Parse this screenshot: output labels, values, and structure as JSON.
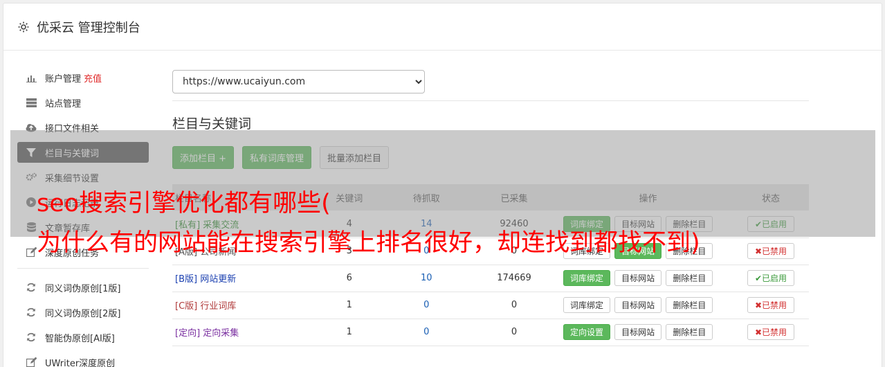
{
  "header": {
    "title": "优采云 管理控制台",
    "icon": "gear-icon"
  },
  "sidebar": {
    "items": [
      {
        "label": "账户管理",
        "badge": "充值",
        "icon": "bar-chart-icon"
      },
      {
        "label": "站点管理",
        "icon": "server-icon"
      },
      {
        "label": "接口文件相关",
        "icon": "cloud-upload-icon"
      },
      {
        "label": "栏目与关键词",
        "icon": "filter-icon"
      },
      {
        "label": "采集细节设置",
        "icon": "gears-icon"
      },
      {
        "label": "运行日志记录",
        "icon": "play-circle-icon"
      },
      {
        "label": "文章暂存库",
        "icon": "database-icon"
      },
      {
        "label": "深度原创任务",
        "icon": "edit-icon"
      }
    ],
    "tools": [
      {
        "label": "同义词伪原创[1版]",
        "icon": "refresh-icon"
      },
      {
        "label": "同义词伪原创[2版]",
        "icon": "refresh-icon"
      },
      {
        "label": "智能伪原创[AI版]",
        "icon": "refresh-icon"
      },
      {
        "label": "UWriter深度原创",
        "icon": "edit-icon"
      }
    ]
  },
  "main": {
    "site_select": "https://www.ucaiyun.com",
    "section_title": "栏目与关键词",
    "buttons": {
      "add_column": "添加栏目 +",
      "private_lib": "私有词库管理",
      "batch_add": "批量添加栏目"
    },
    "table": {
      "headers": [
        "栏目名称",
        "关键词",
        "待抓取",
        "已采集",
        "操作",
        "状态"
      ],
      "rows": [
        {
          "tag": "[私有]",
          "name": "采集交流",
          "keywords": "4",
          "pending": "14",
          "collected": "92460",
          "op1": "词库绑定",
          "op2": "目标网站",
          "op3": "删除栏目",
          "status": "✔已启用"
        },
        {
          "tag": "[A版]",
          "name": "公司新闻",
          "keywords": "3",
          "pending": "0",
          "collected": "0",
          "op1": "词库绑定",
          "op2": "目标网站",
          "op3": "删除栏目",
          "status": "✖已禁用"
        },
        {
          "tag": "[B版]",
          "name": "网站更新",
          "keywords": "6",
          "pending": "10",
          "collected": "174669",
          "op1": "词库绑定",
          "op2": "目标网站",
          "op3": "删除栏目",
          "status": "✔已启用"
        },
        {
          "tag": "[C版]",
          "name": "行业词库",
          "keywords": "1",
          "pending": "0",
          "collected": "0",
          "op1": "词库绑定",
          "op2": "目标网站",
          "op3": "删除栏目",
          "status": "✖已禁用"
        },
        {
          "tag": "[定向]",
          "name": "定向采集",
          "keywords": "1",
          "pending": "0",
          "collected": "0",
          "op1": "定向设置",
          "op2": "目标网站",
          "op3": "删除栏目",
          "status": "✖已禁用"
        }
      ]
    }
  },
  "overlay": {
    "line1": "seo搜索引擎优化都有哪些(",
    "line2": "为什么有的网站能在搜索引擎上排名很好，却连找到都找不到)"
  },
  "colors": {
    "primary_green": "#5cb85c",
    "active_nav": "#555555",
    "overlay_text": "#ff0000",
    "disabled_red": "#d23030"
  }
}
